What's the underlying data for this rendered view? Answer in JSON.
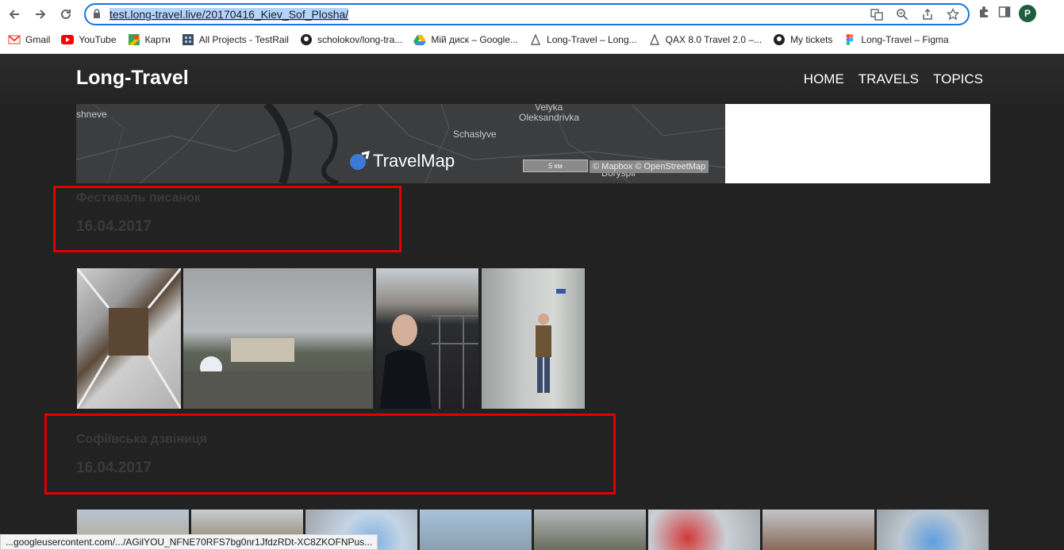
{
  "browser": {
    "url_prefix": "test.long-travel.live/20170416_Kiev_Sof_Plosha/",
    "profile_initial": "P",
    "bookmarks": [
      {
        "label": "Gmail",
        "icon": "gmail-icon"
      },
      {
        "label": "YouTube",
        "icon": "youtube-icon"
      },
      {
        "label": "Карти",
        "icon": "maps-icon"
      },
      {
        "label": "All Projects - TestRail",
        "icon": "testrail-icon"
      },
      {
        "label": "scholokov/long-tra...",
        "icon": "github-icon"
      },
      {
        "label": "Мій диск – Google...",
        "icon": "drive-icon"
      },
      {
        "label": "Long-Travel – Long...",
        "icon": "site-icon"
      },
      {
        "label": "QAX 8.0 Travel 2.0 –...",
        "icon": "site-icon"
      },
      {
        "label": "My tickets",
        "icon": "github-icon"
      },
      {
        "label": "Long-Travel – Figma",
        "icon": "figma-icon"
      }
    ],
    "status_url": "...googleusercontent.com/.../AGilYOU_NFNE70RFS7bg0nr1JfdzRDt-XC8ZKOFNPus..."
  },
  "site": {
    "logo": "Long-Travel",
    "nav": [
      "HOME",
      "TRAVELS",
      "TOPICS"
    ]
  },
  "map": {
    "labels": [
      "shneve",
      "Velyka",
      "Oleksandrivka",
      "Schaslyve",
      "Boryspil"
    ],
    "brand": "TravelMap",
    "scale": "5 км",
    "attribution": "© Mapbox © OpenStreetMap"
  },
  "sections": [
    {
      "title": "Фестиваль писанок",
      "date": "16.04.2017"
    },
    {
      "title": "Софіївська дзвіниця",
      "date": "16.04.2017"
    }
  ],
  "colors": {
    "highlight_box": "#e00000",
    "page_bg": "#222222"
  }
}
